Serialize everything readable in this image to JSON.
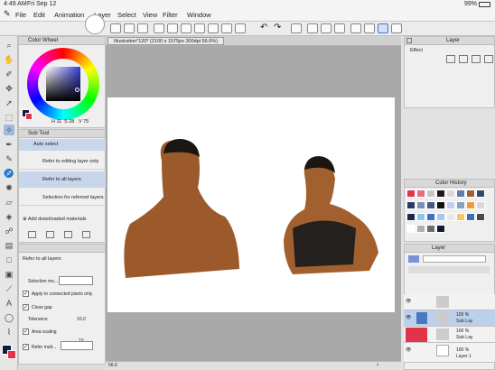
{
  "status": {
    "time": "4:49 AM",
    "date": "Fri Sep 12",
    "battery": "99%"
  },
  "menu": {
    "items": [
      "File",
      "Edit",
      "Animation",
      "Layer",
      "Select",
      "View",
      "Filter",
      "Window"
    ]
  },
  "doc_tab": {
    "label": "Illustration*120* (2100 x 1575px 300dpi 56.6%)"
  },
  "color_wheel": {
    "title": "Color Wheel",
    "values": [
      "H 11",
      "S 28",
      "V 75"
    ]
  },
  "sub_tool": {
    "title": "Sub Tool",
    "items": [
      "Auto select",
      "Refer to editing layer only",
      "Refer to all layers",
      "Selection for referred layers"
    ],
    "add_label": "Add downloaded materials"
  },
  "tool_property": {
    "title": "Refer to all layers",
    "selection_mode_label": "Selection mo...",
    "apply_label": "Apply to connected pixels only",
    "close_gap_label": "Close gap",
    "tolerance_label": "Tolerance",
    "tolerance_value": "10.0",
    "area_scaling_label": "Area scaling",
    "area_scaling_value": "10",
    "refer_label": "Refer mult..."
  },
  "layer_property": {
    "title": "Layer",
    "effect_label": "Effect"
  },
  "color_history": {
    "title": "Color History"
  },
  "layers": {
    "title": "Layer",
    "rows": [
      {
        "name": "",
        "percent": ""
      },
      {
        "name": "Sub Lay",
        "percent": "100 %"
      },
      {
        "name": "Sub Lay",
        "percent": "100 %"
      },
      {
        "name": "Layer 1",
        "percent": "100 %"
      }
    ]
  },
  "bottombar": {
    "zoom": "56.6"
  },
  "colors": {
    "accent": "#4a78c2",
    "selection": "#c7d6ea",
    "brand_red": "#e0344a"
  }
}
